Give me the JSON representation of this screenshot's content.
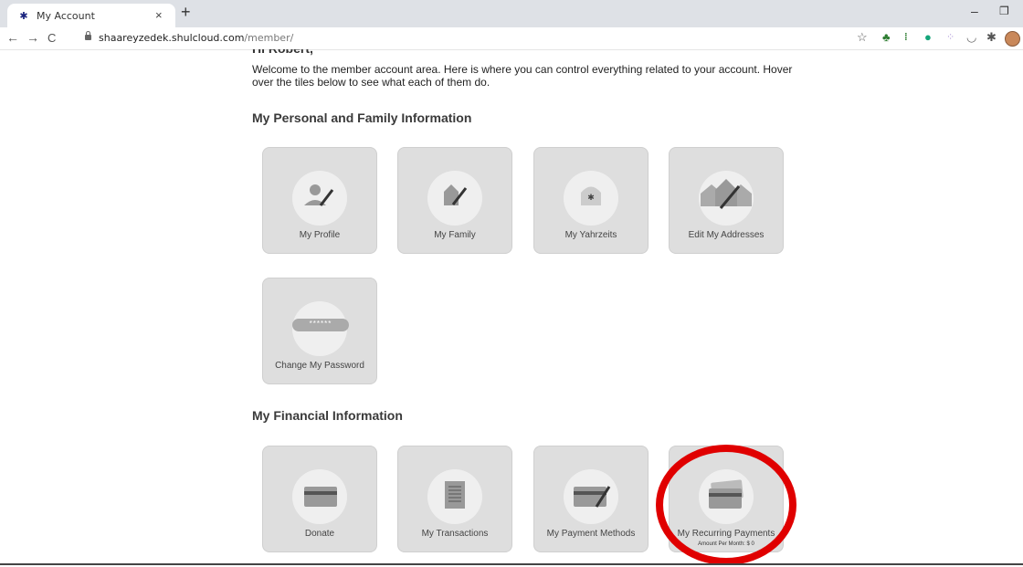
{
  "browser": {
    "tab_title": "My Account",
    "tab_close": "×",
    "new_tab": "+",
    "minimize": "–",
    "restore": "❐",
    "back": "←",
    "forward": "→",
    "reload": "C",
    "url_host": "shaareyzedek.shulcloud.com",
    "url_path": "/member/",
    "star": "☆"
  },
  "page": {
    "greeting_cut": "Hi Robert,",
    "intro": "Welcome to the member account area. Here is where you can control everything related to your account. Hover over the tiles below to see what each of them do.",
    "sections": [
      {
        "title": "My Personal and Family Information",
        "tiles": [
          {
            "label": "My Profile",
            "icon": "profile-edit-icon"
          },
          {
            "label": "My Family",
            "icon": "family-home-icon"
          },
          {
            "label": "My Yahrzeits",
            "icon": "yahrzeit-icon"
          },
          {
            "label": "Edit My Addresses",
            "icon": "addresses-icon"
          },
          {
            "label": "Change My Password",
            "icon": "password-icon",
            "password_mask": "******"
          }
        ]
      },
      {
        "title": "My Financial Information",
        "tiles": [
          {
            "label": "Donate",
            "icon": "card-icon"
          },
          {
            "label": "My Transactions",
            "icon": "document-icon"
          },
          {
            "label": "My Payment Methods",
            "icon": "card-edit-icon"
          },
          {
            "label": "My Recurring Payments",
            "icon": "recurring-cards-icon",
            "sub_label": "Amount Per Month: $ 0"
          }
        ]
      }
    ]
  },
  "colors": {
    "tile_bg": "#dedede",
    "highlight_ring": "#e00000"
  }
}
